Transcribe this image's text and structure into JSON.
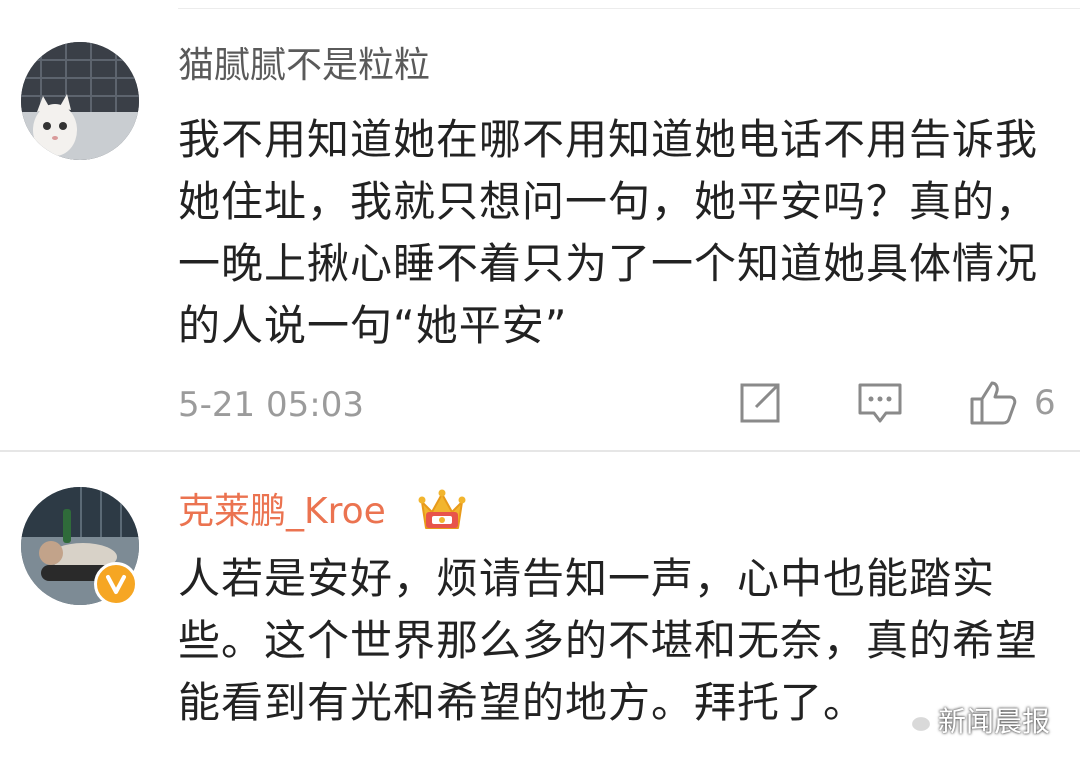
{
  "comments": [
    {
      "username": "猫腻腻不是粒粒",
      "text": "我不用知道她在哪不用知道她电话不用告诉我她住址，我就只想问一句，她平安吗？真的，一晚上揪心睡不着只为了一个知道她具体情况的人说一句“她平安”",
      "timestamp": "5-21 05:03",
      "like_count": "6",
      "avatar_icon": "cat-photo-avatar"
    },
    {
      "username": "克莱鹏_Kroe",
      "username_color": "#eb7350",
      "badge_icon": "crown-icon",
      "verified_icon": "verified-v-icon",
      "text": "人若是安好，烦请告知一声，心中也能踏实些。这个世界那么多的不堪和无奈，真的希望能看到有光和希望的地方。拜托了。",
      "avatar_icon": "person-reclining-photo-avatar"
    }
  ],
  "icons": {
    "repost": "repost-icon",
    "comment": "comment-icon",
    "like": "thumbs-up-icon"
  },
  "watermark": {
    "text": "新闻晨报",
    "icon": "wechat-icon"
  },
  "colors": {
    "username_default": "#5a5a5a",
    "username_vip": "#eb7350",
    "meta": "#9b9b9b",
    "text": "#222222",
    "verified": "#f6a623"
  }
}
